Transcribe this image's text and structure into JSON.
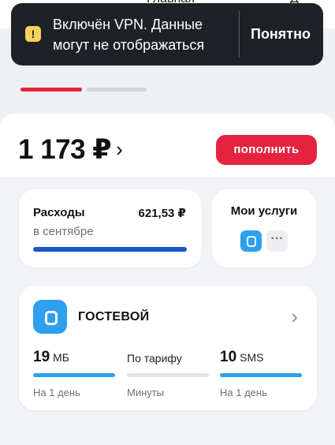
{
  "topbar": {
    "partial_left": "Главная",
    "partial_right": "Д"
  },
  "toast": {
    "message": "Включён VPN. Данные могут не отображаться",
    "action_label": "Понятно",
    "warn_glyph": "!"
  },
  "pager": {
    "active_index": 0,
    "count": 2
  },
  "balance": {
    "amount": "1 173 ₽",
    "chevron": "›"
  },
  "topup_label": "пополнить",
  "expenses": {
    "title": "Расходы",
    "amount": "621,53 ₽",
    "period": "в сентябре"
  },
  "services": {
    "title": "Мои услуги",
    "more_glyph": "···"
  },
  "tariff": {
    "name": "ГОСТЕВОЙ",
    "chevron": "›",
    "items": [
      {
        "value": "19",
        "unit": "МБ",
        "caption": "На 1 день",
        "bar": "blue"
      },
      {
        "value": "По тарифу",
        "unit": "",
        "caption": "Минуты",
        "bar": "grey"
      },
      {
        "value": "10",
        "unit": "SMS",
        "caption": "На 1 день",
        "bar": "blue"
      }
    ]
  },
  "colors": {
    "accent_red": "#e4243f",
    "accent_blue": "#2f9ff0",
    "toast_bg": "#1e2126",
    "warning_yellow": "#f7d35c"
  }
}
